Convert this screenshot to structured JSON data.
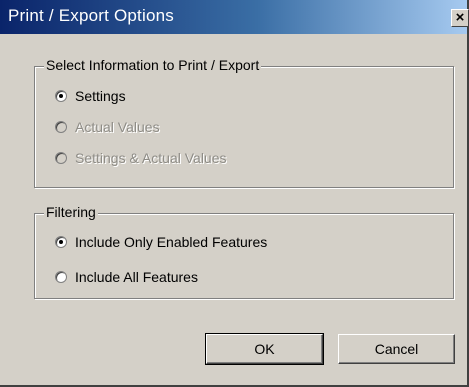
{
  "window": {
    "title": "Print / Export Options",
    "close_glyph": "×"
  },
  "select_group": {
    "legend": "Select Information to Print / Export",
    "options": [
      {
        "label": "Settings",
        "checked": true,
        "enabled": true
      },
      {
        "label": "Actual Values",
        "checked": false,
        "enabled": false
      },
      {
        "label": "Settings & Actual Values",
        "checked": false,
        "enabled": false
      }
    ]
  },
  "filter_group": {
    "legend": "Filtering",
    "options": [
      {
        "label": "Include Only Enabled Features",
        "checked": true,
        "enabled": true
      },
      {
        "label": "Include All Features",
        "checked": false,
        "enabled": true
      }
    ]
  },
  "buttons": {
    "ok_label": "OK",
    "cancel_label": "Cancel"
  },
  "colors": {
    "title_bar_start": "#0a246a",
    "title_bar_end": "#a6caf0",
    "dialog_face": "#d4d0c8",
    "disabled_text": "#8e8c86"
  }
}
